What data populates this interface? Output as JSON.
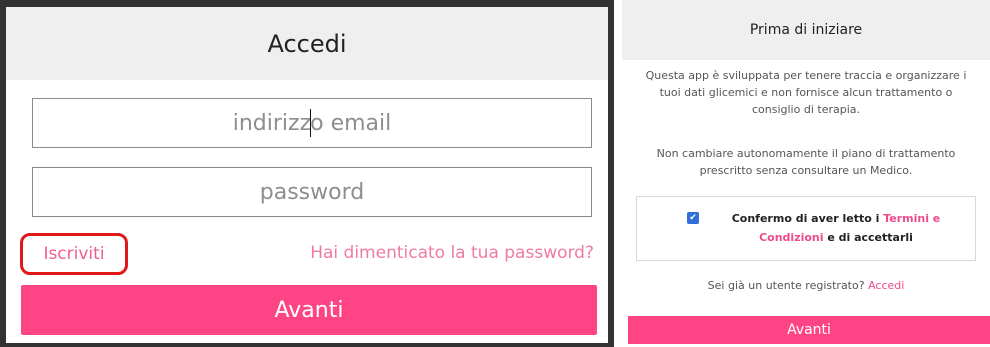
{
  "login": {
    "title": "Accedi",
    "email_placeholder_before_caret": "indirizz",
    "email_placeholder_after_caret": "o email",
    "password_placeholder": "password",
    "signup_link": "Iscriviti",
    "forgot_link": "Hai dimenticato la tua password?",
    "submit_label": "Avanti"
  },
  "disclaimer": {
    "title": "Prima di iniziare",
    "paragraph_1": "Questa app è sviluppata per tenere traccia e organizzare i tuoi dati glicemici e non fornisce alcun trattamento o consiglio di terapia.",
    "paragraph_2": "Non cambiare autonomamente il piano di trattamento prescritto senza consultare un Medico.",
    "consent": {
      "checked": true,
      "text_before": "Confermo di aver letto i ",
      "link_text": "Termini e Condizioni",
      "text_after": " e di accettarli"
    },
    "registered_text": "Sei già un utente registrato? ",
    "registered_link": "Accedi",
    "submit_label": "Avanti"
  },
  "colors": {
    "accent": "#ff4486",
    "link": "#ee4a8c",
    "highlight": "#e01818",
    "checkbox": "#2f6fd6"
  }
}
